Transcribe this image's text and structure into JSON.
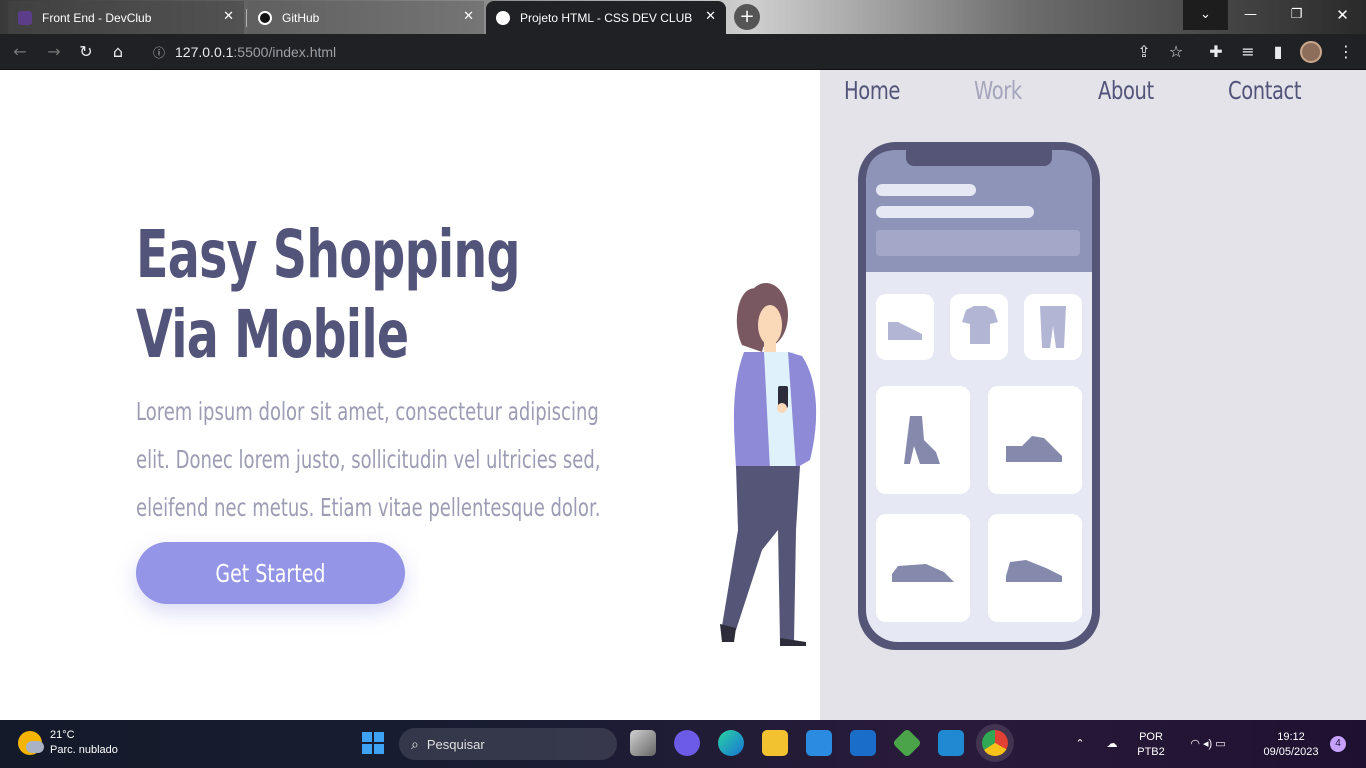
{
  "browser": {
    "tabs": [
      {
        "title": "Front End - DevClub",
        "active": false
      },
      {
        "title": "GitHub",
        "active": false
      },
      {
        "title": "Projeto HTML - CSS DEV CLUB",
        "active": true
      }
    ],
    "url_host": "127.0.0.1",
    "url_path": ":5500/index.html"
  },
  "nav": {
    "items": [
      {
        "label": "Home",
        "active": false
      },
      {
        "label": "Work",
        "active": true
      },
      {
        "label": "About",
        "active": false
      },
      {
        "label": "Contact",
        "active": false
      }
    ]
  },
  "hero": {
    "title_line1": "Easy Shopping",
    "title_line2": "Via Mobile",
    "text_line1": "Lorem ipsum dolor sit amet, consectetur adipiscing",
    "text_line2": "elit. Donec lorem justo, sollicitudin vel ultricies sed,",
    "text_line3": "eleifend nec metus. Etiam vitae pellentesque dolor.",
    "cta_label": "Get Started"
  },
  "colors": {
    "primary_text": "#53547a",
    "muted_text": "#9c9cb4",
    "accent": "#9495e6",
    "panel_bg": "#e4e3ea"
  },
  "taskbar": {
    "weather_temp": "21°C",
    "weather_desc": "Parc. nublado",
    "search_placeholder": "Pesquisar",
    "lang_line1": "POR",
    "lang_line2": "PTB2",
    "time": "19:12",
    "date": "09/05/2023",
    "notifications": "4"
  }
}
